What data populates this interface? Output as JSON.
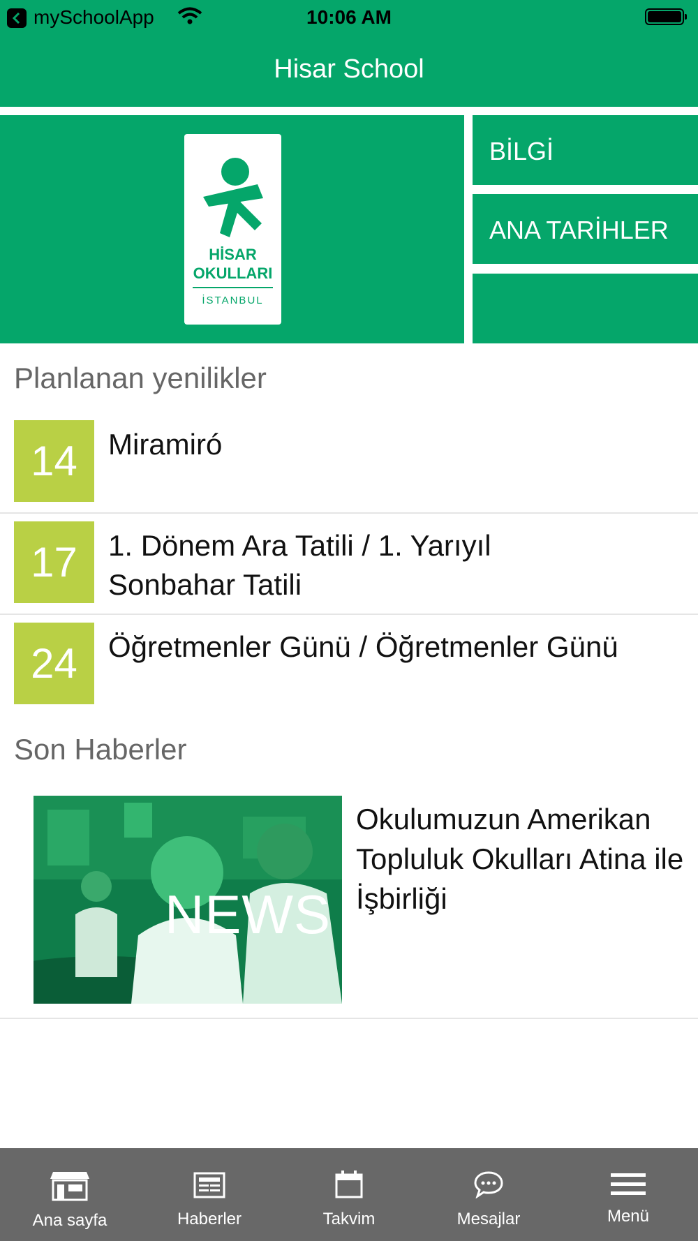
{
  "status_bar": {
    "app_name": "mySchoolApp",
    "time": "10:06 AM"
  },
  "header": {
    "title": "Hisar School"
  },
  "logo": {
    "line1": "HİSAR",
    "line2": "OKULLARI",
    "line3": "İSTANBUL"
  },
  "tiles": [
    {
      "label": "BİLGİ"
    },
    {
      "label": "ANA TARİHLER"
    },
    {
      "label": ""
    }
  ],
  "events_section": {
    "title": "Planlanan yenilikler",
    "items": [
      {
        "day": "14",
        "title": "Miramiró"
      },
      {
        "day": "17",
        "title": "1. Dönem Ara Tatili / 1. Yarıyıl Sonbahar Tatili"
      },
      {
        "day": "24",
        "title": "Öğretmenler Günü / Öğretmenler Günü"
      }
    ]
  },
  "news_section": {
    "title": "Son Haberler",
    "items": [
      {
        "image_overlay": "NEWS",
        "title": "Okulumuzun Amerikan Topluluk Okulları Atina ile İşbirliği"
      }
    ]
  },
  "tabbar": {
    "items": [
      {
        "label": "Ana sayfa",
        "icon": "home-icon"
      },
      {
        "label": "Haberler",
        "icon": "news-icon"
      },
      {
        "label": "Takvim",
        "icon": "calendar-icon"
      },
      {
        "label": "Mesajlar",
        "icon": "chat-icon"
      },
      {
        "label": "Menü",
        "icon": "menu-icon"
      }
    ]
  },
  "colors": {
    "brand_green": "#05a66a",
    "date_box": "#b9d045",
    "tabbar": "#686868"
  }
}
